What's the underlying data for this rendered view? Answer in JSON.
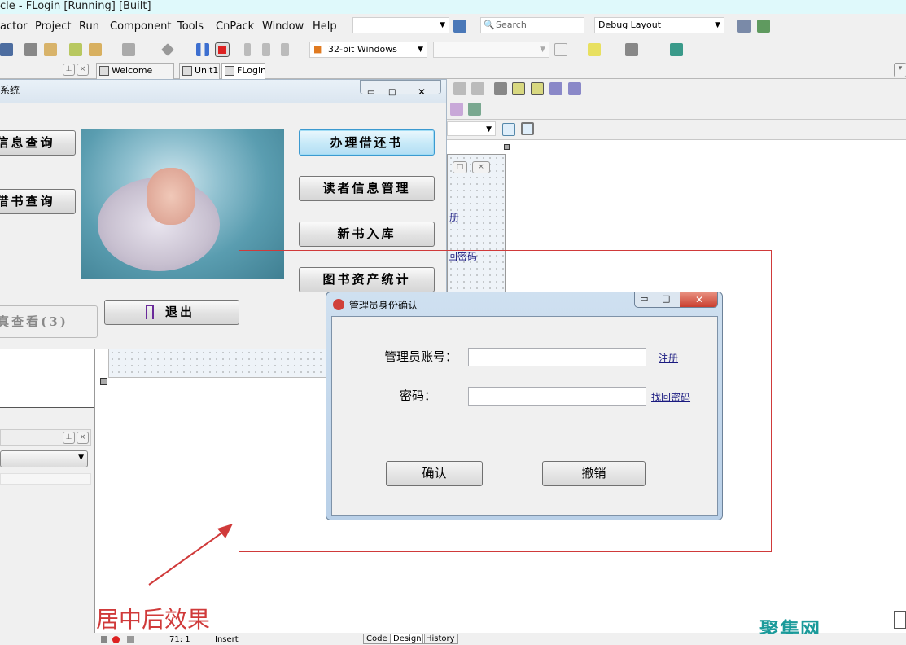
{
  "window": {
    "title": "cle - FLogin [Running] [Built]"
  },
  "menu": [
    "actor",
    "Project",
    "Run",
    "Component",
    "Tools",
    "CnPack",
    "Window",
    "Help"
  ],
  "toolbar": {
    "search_placeholder": "Search",
    "layout": "Debug Layout",
    "platform": "32-bit Windows"
  },
  "tabs": [
    "Welcome Page",
    "Unit1",
    "FLogin"
  ],
  "app": {
    "title": "系统",
    "buttons_left": [
      "信息查询",
      "借书查询"
    ],
    "buttons_right": [
      "办理借还书",
      "读者信息管理",
      "新书入库",
      "图书资产统计"
    ],
    "disabled_button": "真查看(3)",
    "exit_button": "退出"
  },
  "designer": {
    "link_register": "册",
    "link_recover": "回密码"
  },
  "dialog": {
    "title": "管理员身份确认",
    "account_label": "管理员账号：",
    "password_label": "密码：",
    "account_value": "",
    "password_value": "",
    "register_link": "注册",
    "recover_link": "找回密码",
    "confirm": "确认",
    "cancel": "撤销"
  },
  "annotation": {
    "caption": "居中后效果",
    "color": "#d03a3a"
  },
  "watermark": "聚集网",
  "status": {
    "position": "71: 1",
    "mode": "Insert",
    "tabs": [
      "Code",
      "Design",
      "History"
    ]
  }
}
